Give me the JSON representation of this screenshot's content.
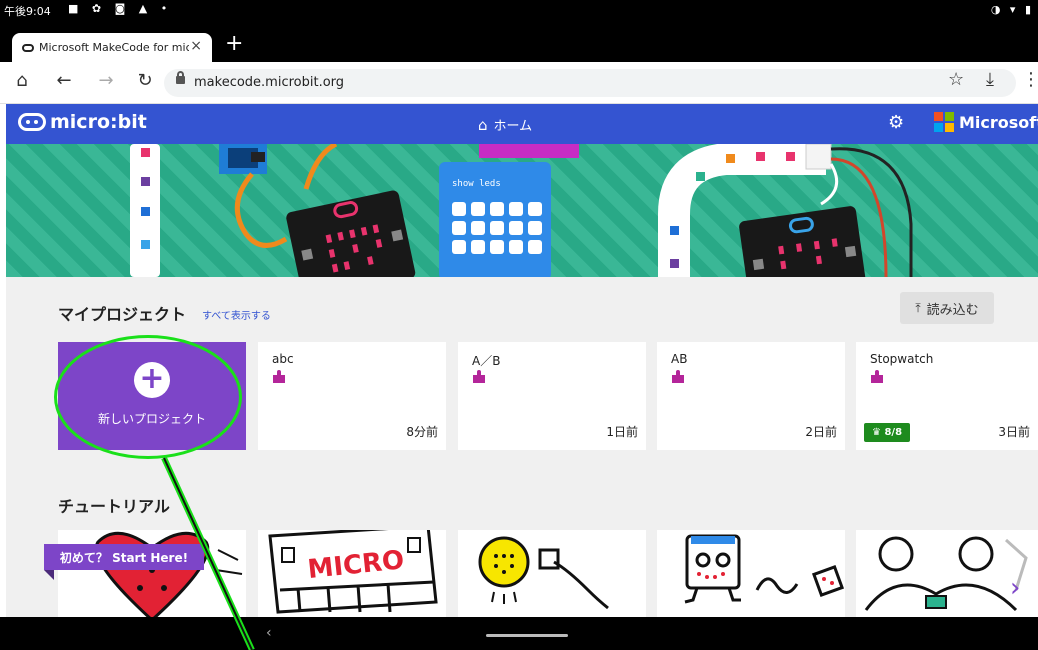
{
  "status_bar": {
    "time": "午後9:04"
  },
  "browser": {
    "tab_title": "Microsoft MakeCode for micro:bit",
    "url": "makecode.microbit.org"
  },
  "header": {
    "logo_text": "micro:bit",
    "home_label": "ホーム",
    "brand": "Microsoft",
    "brand_colors": [
      "#f25022",
      "#7fba00",
      "#00a4ef",
      "#ffb900"
    ]
  },
  "my_projects": {
    "title": "マイプロジェクト",
    "show_all": "すべて表示する",
    "import_label": "読み込む",
    "new_project_label": "新しいプロジェクト",
    "projects": [
      {
        "name": "abc",
        "time": "8分前"
      },
      {
        "name": "A／B",
        "time": "1日前"
      },
      {
        "name": "AB",
        "time": "2日前"
      },
      {
        "name": "Stopwatch",
        "time": "3日前",
        "badge": "8/8"
      }
    ]
  },
  "tutorials": {
    "title": "チュートリアル",
    "start_here": "初めて？ Start Here!"
  },
  "hero": {
    "block_text": "show leds"
  },
  "colors": {
    "accent": "#3454d1",
    "purple": "#7d45c8",
    "teal": "#2bb28e",
    "annotation": "#1ae01a"
  }
}
